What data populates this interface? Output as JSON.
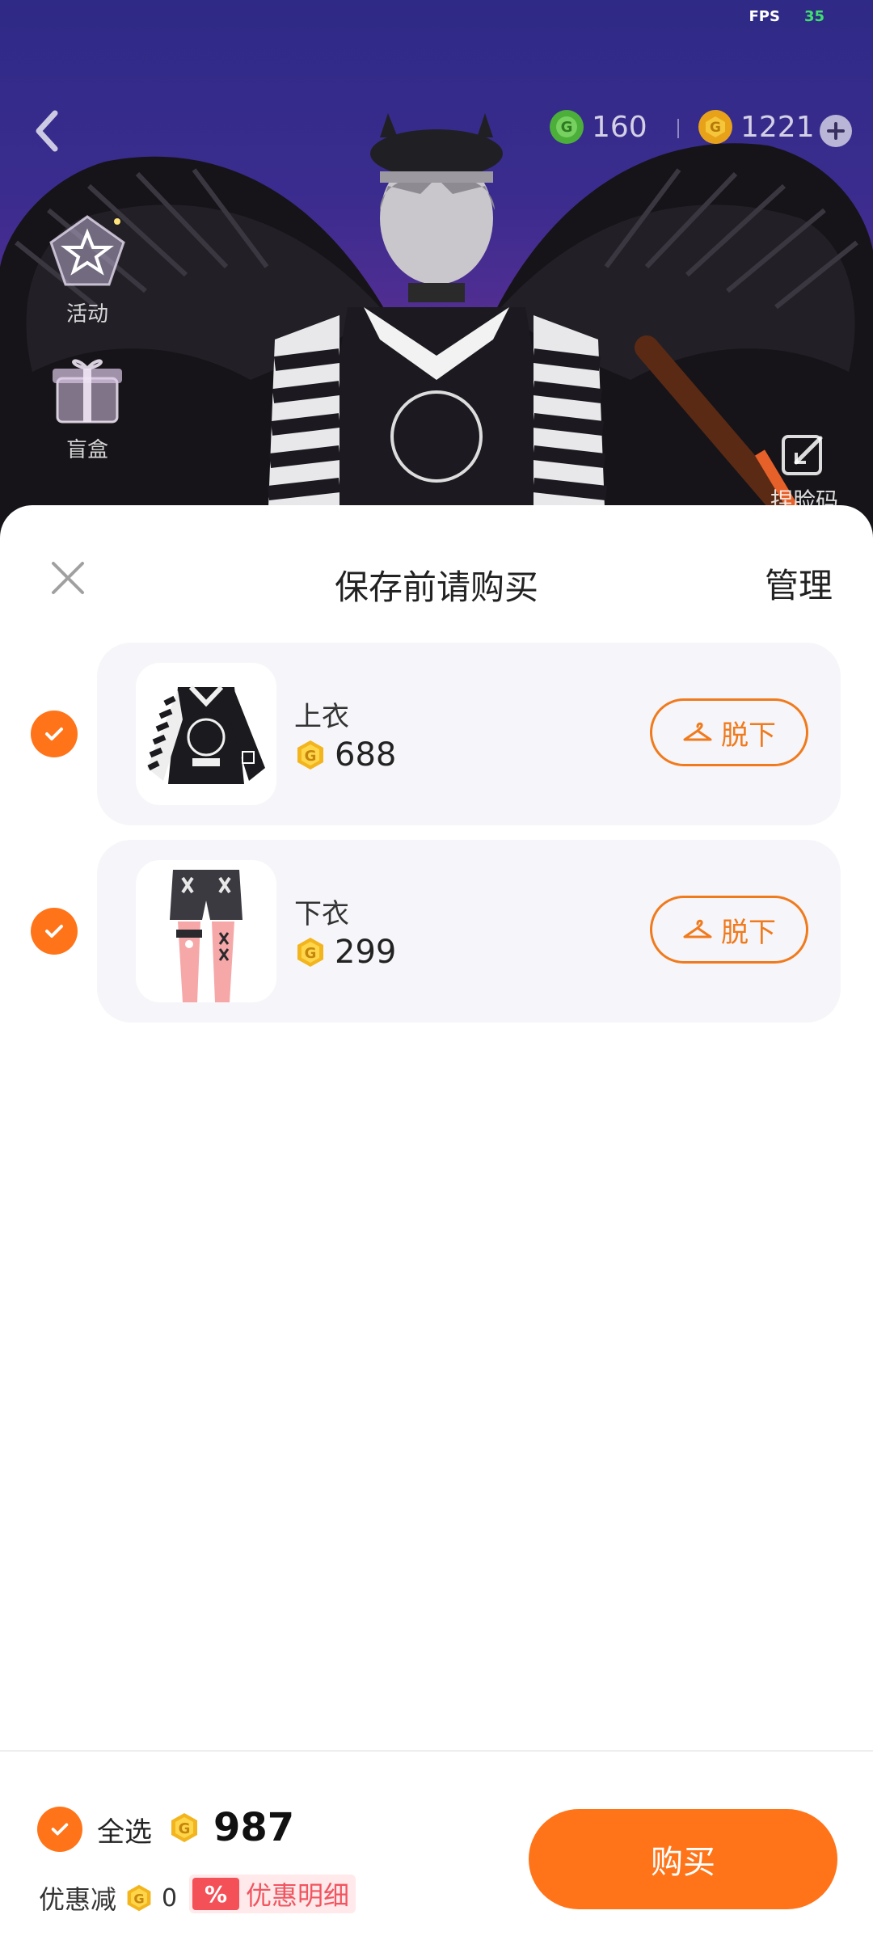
{
  "status": {
    "fps_label": "FPS",
    "fps_value": "35"
  },
  "topbar": {
    "back_icon": "chevron-left-icon",
    "currencies": [
      {
        "icon": "green-coin-icon",
        "amount": "160",
        "color": "#4caf3a"
      },
      {
        "icon": "gold-coin-icon",
        "amount": "1221",
        "color": "#e8a21a"
      }
    ],
    "add_icon": "plus-icon"
  },
  "sidebar": {
    "items": [
      {
        "label": "活动",
        "icon": "star-badge-icon"
      },
      {
        "label": "盲盒",
        "icon": "gift-box-icon"
      }
    ]
  },
  "pinch_face": {
    "label": "捏脸码",
    "icon": "edit-face-icon"
  },
  "sheet": {
    "title": "保存前请购买",
    "manage": "管理",
    "close_icon": "close-icon",
    "items": [
      {
        "name": "上衣",
        "price": "688",
        "action": "脱下",
        "checked": true,
        "thumbnail": "striped-jacket-image"
      },
      {
        "name": "下衣",
        "price": "299",
        "action": "脱下",
        "checked": true,
        "thumbnail": "shorts-with-stockings-image"
      }
    ]
  },
  "footer": {
    "select_all": "全选",
    "total": "987",
    "discount_label": "优惠减",
    "discount_amount": "0",
    "detail_badge": "%",
    "detail_label": "优惠明细",
    "buy": "购买"
  },
  "colors": {
    "accent": "#ff7419",
    "coin_gold": "#f2b51e",
    "scene_top": "#2f2a86",
    "scene_bottom": "#7a3aa0",
    "discount_red": "#f45057"
  }
}
